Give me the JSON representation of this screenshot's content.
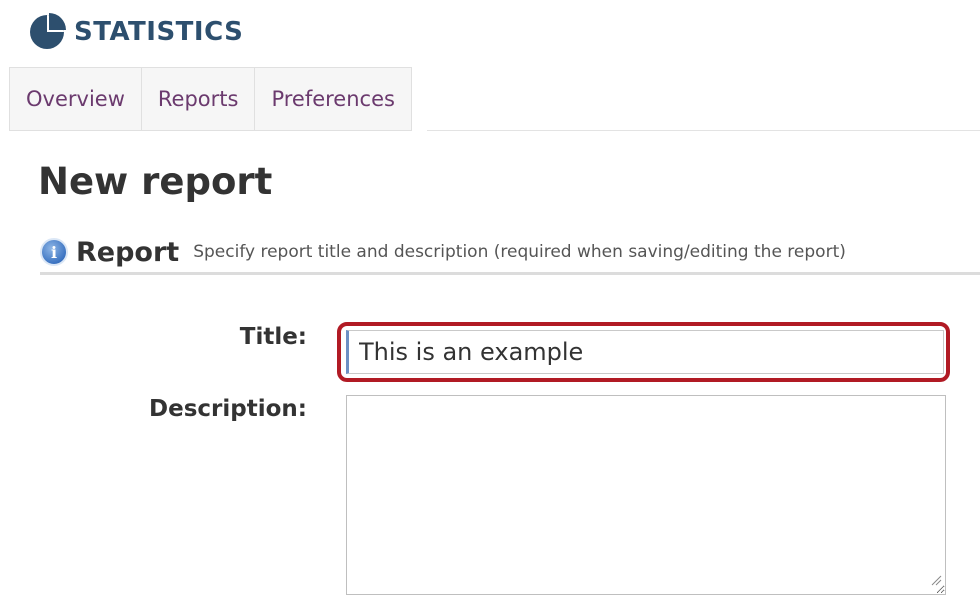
{
  "header": {
    "title": "STATISTICS",
    "icon": "pie-chart-icon",
    "color": "#2d4f6e"
  },
  "tabs": [
    {
      "label": "Overview"
    },
    {
      "label": "Reports"
    },
    {
      "label": "Preferences"
    }
  ],
  "page": {
    "title": "New report"
  },
  "section": {
    "icon": "info-icon",
    "info_glyph": "i",
    "title": "Report",
    "description": "Specify report title and description (required when saving/editing the report)"
  },
  "form": {
    "title_label": "Title:",
    "title_value": "This is an example",
    "description_label": "Description:",
    "description_value": ""
  },
  "colors": {
    "tab_link": "#6b3a6e",
    "highlight": "#b11a24"
  }
}
